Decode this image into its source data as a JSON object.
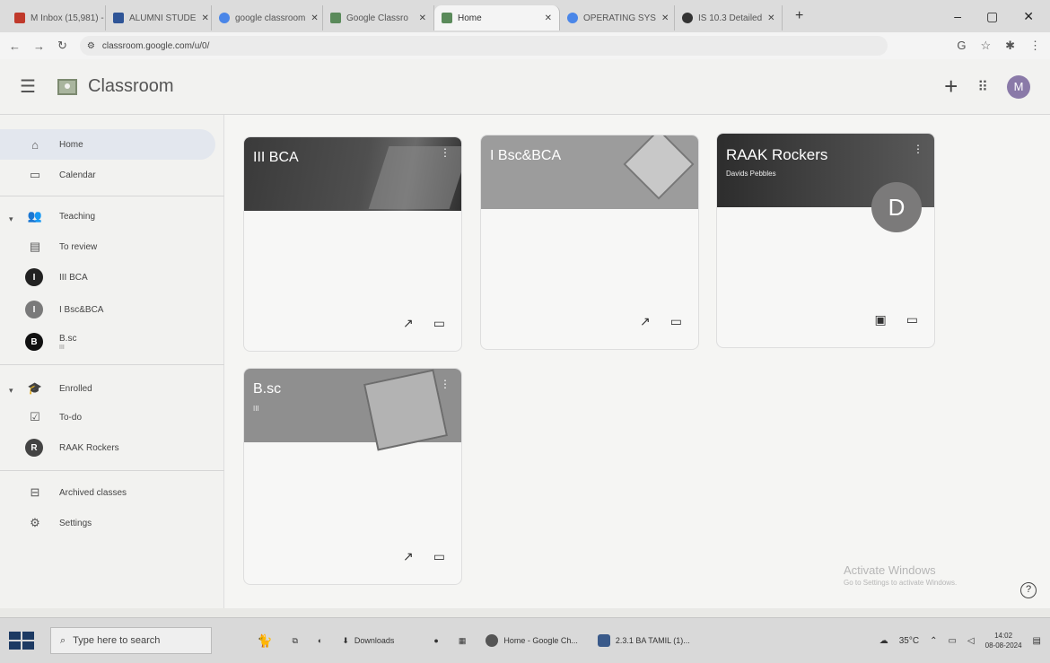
{
  "browser": {
    "tabs": [
      {
        "label": "M Inbox (15,981) -",
        "color": "#c0392b"
      },
      {
        "label": "ALUMNI STUDE",
        "color": "#2f5597"
      },
      {
        "label": "google classroom",
        "color": "#4a86e8"
      },
      {
        "label": "Google Classro",
        "color": "#5a8a5a"
      },
      {
        "label": "Home",
        "color": "#5a8a5a"
      },
      {
        "label": "OPERATING SYS",
        "color": "#4a86e8"
      },
      {
        "label": "IS 10.3 Detailed",
        "color": "#333333"
      }
    ],
    "active_tab": "Home",
    "new_tab": "+",
    "url": "classroom.google.com/u/0/",
    "window": {
      "minimize": "–",
      "maximize": "▢",
      "close": "✕"
    }
  },
  "header": {
    "menu_icon": "☰",
    "title": "Classroom",
    "plus": "+",
    "apps_icon": "⋮⋮⋮",
    "avatar": "M"
  },
  "sidebar": {
    "home": "Home",
    "calendar": "Calendar",
    "teaching": "Teaching",
    "to_review": "To review",
    "teach_classes": [
      {
        "initial": "I",
        "label": "III BCA",
        "sub": "",
        "color": "#222222"
      },
      {
        "initial": "I",
        "label": "I Bsc&BCA",
        "sub": "",
        "color": "#7a7a7a"
      },
      {
        "initial": "B",
        "label": "B.sc",
        "sub": "III",
        "color": "#111111"
      }
    ],
    "enrolled": "Enrolled",
    "todo": "To-do",
    "enrolled_classes": [
      {
        "initial": "R",
        "label": "RAAK Rockers",
        "color": "#444444"
      }
    ],
    "archived": "Archived classes",
    "settings": "Settings"
  },
  "cards": [
    {
      "title": "III BCA",
      "sub": "",
      "banner": "#3e3e3e"
    },
    {
      "title": "I Bsc&BCA",
      "sub": "",
      "banner": "#9a9a9a"
    },
    {
      "title": "RAAK Rockers",
      "sub": "Davids Pebbles",
      "banner": "#3d3d3d",
      "teacher_initial": "D"
    },
    {
      "title": "B.sc",
      "sub": "III",
      "banner": "#8f8f8f"
    }
  ],
  "watermark": {
    "line1": "Activate Windows",
    "line2": "Go to Settings to activate Windows."
  },
  "help": "?",
  "taskbar": {
    "search_placeholder": "Type here to search",
    "downloads": "Downloads",
    "chrome_item": "Home - Google Ch...",
    "doc_item": "2.3.1 BA TAMIL (1)...",
    "temp": "35°C",
    "time": "14:02",
    "date": "08-08-2024"
  }
}
